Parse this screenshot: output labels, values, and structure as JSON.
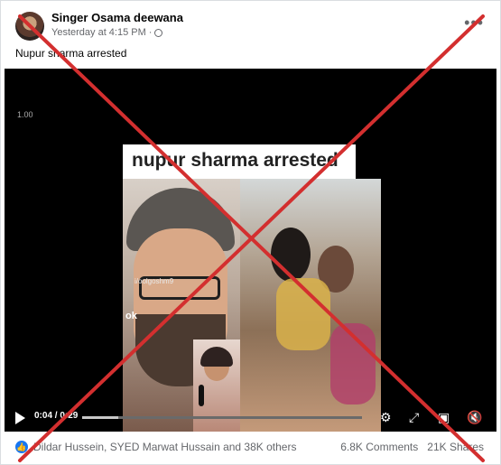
{
  "post": {
    "author": "Singer Osama deewana",
    "timestamp": "Yesterday at 4:15 PM",
    "privacy_separator": "·",
    "caption": "Nupur sharma arrested",
    "more_icon": "more-options-icon"
  },
  "video": {
    "playback_speed": "1.00",
    "overlay_title": "nupur sharma arrested",
    "watermark_main": "ok",
    "watermark_handle": "i/oolgoshm9",
    "time_display": "0:04 / 0:29",
    "progress_fraction": 0.13,
    "controls": {
      "play_icon": "play-icon",
      "settings_icon": "gear-icon",
      "fullscreen_icon": "expand-icon",
      "pip_icon": "picture-in-picture-icon",
      "volume_icon": "volume-muted-icon"
    }
  },
  "engagement": {
    "reactions_text": "Dildar Hussein, SYED Marwat Hussain and 38K others",
    "comments": "6.8K Comments",
    "shares": "21K Shares"
  },
  "overlay": {
    "color": "#d32f2f"
  }
}
